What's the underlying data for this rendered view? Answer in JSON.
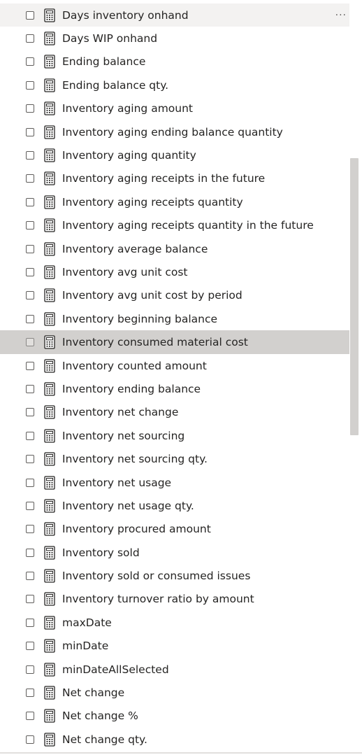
{
  "field_list": {
    "more_options_glyph": "···",
    "icon": "calculator-icon",
    "items": [
      {
        "label": "Days inventory onhand",
        "state": "hovered"
      },
      {
        "label": "Days WIP onhand",
        "state": "normal"
      },
      {
        "label": "Ending balance",
        "state": "normal"
      },
      {
        "label": "Ending balance qty.",
        "state": "normal"
      },
      {
        "label": "Inventory aging amount",
        "state": "normal"
      },
      {
        "label": "Inventory aging ending balance quantity",
        "state": "normal"
      },
      {
        "label": "Inventory aging quantity",
        "state": "normal"
      },
      {
        "label": "Inventory aging receipts in the future",
        "state": "normal"
      },
      {
        "label": "Inventory aging receipts quantity",
        "state": "normal"
      },
      {
        "label": "Inventory aging receipts quantity in the future",
        "state": "normal"
      },
      {
        "label": "Inventory average balance",
        "state": "normal"
      },
      {
        "label": "Inventory avg unit cost",
        "state": "normal"
      },
      {
        "label": "Inventory avg unit cost by period",
        "state": "normal"
      },
      {
        "label": "Inventory beginning balance",
        "state": "normal"
      },
      {
        "label": "Inventory consumed material cost",
        "state": "selected"
      },
      {
        "label": "Inventory counted amount",
        "state": "normal"
      },
      {
        "label": "Inventory ending balance",
        "state": "normal"
      },
      {
        "label": "Inventory net change",
        "state": "normal"
      },
      {
        "label": "Inventory net sourcing",
        "state": "normal"
      },
      {
        "label": "Inventory net sourcing qty.",
        "state": "normal"
      },
      {
        "label": "Inventory net usage",
        "state": "normal"
      },
      {
        "label": "Inventory net usage qty.",
        "state": "normal"
      },
      {
        "label": "Inventory procured amount",
        "state": "normal"
      },
      {
        "label": "Inventory sold",
        "state": "normal"
      },
      {
        "label": "Inventory sold or consumed issues",
        "state": "normal"
      },
      {
        "label": "Inventory turnover ratio by amount",
        "state": "normal"
      },
      {
        "label": "maxDate",
        "state": "normal"
      },
      {
        "label": "minDate",
        "state": "normal"
      },
      {
        "label": "minDateAllSelected",
        "state": "normal"
      },
      {
        "label": "Net change",
        "state": "normal"
      },
      {
        "label": "Net change %",
        "state": "normal"
      },
      {
        "label": "Net change qty.",
        "state": "normal"
      }
    ]
  },
  "colors": {
    "hover_row": "#f3f2f1",
    "selected_row": "#d2d0ce",
    "text": "#252423",
    "scrollbar_thumb": "#d2d0ce"
  }
}
